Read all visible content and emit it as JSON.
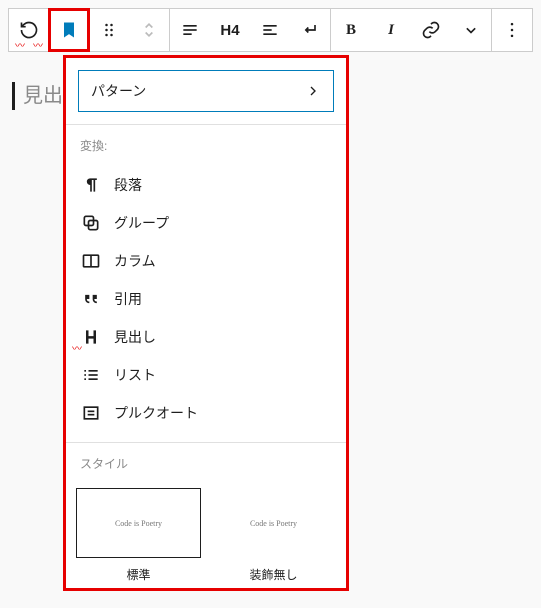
{
  "toolbar": {
    "h4": "H4",
    "bold": "B",
    "italic": "I"
  },
  "placeholder": "見出し",
  "dropdown": {
    "patterns_label": "パターン",
    "transform_label": "変換:",
    "items": [
      {
        "label": "段落",
        "icon": "paragraph"
      },
      {
        "label": "グループ",
        "icon": "group"
      },
      {
        "label": "カラム",
        "icon": "columns"
      },
      {
        "label": "引用",
        "icon": "quote"
      },
      {
        "label": "見出し",
        "icon": "heading",
        "wavy": true
      },
      {
        "label": "リスト",
        "icon": "list"
      },
      {
        "label": "プルクオート",
        "icon": "pullquote"
      }
    ],
    "style_label": "スタイル",
    "styles": [
      {
        "name": "標準",
        "preview": "Code is Poetry",
        "selected": true
      },
      {
        "name": "装飾無し",
        "preview": "Code is Poetry",
        "selected": false
      }
    ]
  }
}
